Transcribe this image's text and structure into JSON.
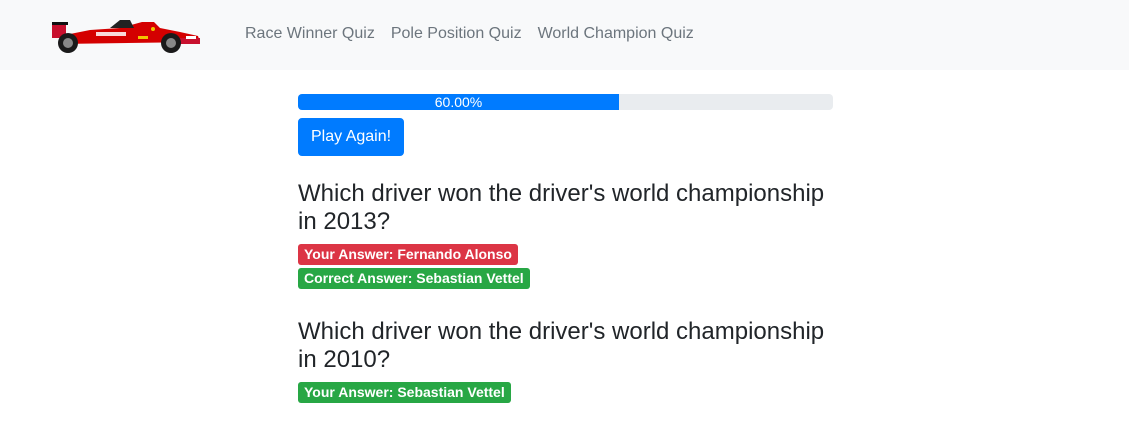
{
  "navbar": {
    "logo_icon": "f1-car-icon",
    "links": [
      {
        "label": "Race Winner Quiz"
      },
      {
        "label": "Pole Position Quiz"
      },
      {
        "label": "World Champion Quiz"
      }
    ]
  },
  "progress": {
    "value": 0.6,
    "label": "60.00%"
  },
  "play_again_label": "Play Again!",
  "questions": [
    {
      "title": "Which driver won the driver's world championship in 2013?",
      "your_answer": "Your Answer: Fernando Alonso",
      "correct_answer": "Correct Answer: Sebastian Vettel"
    },
    {
      "title": "Which driver won the driver's world championship in 2010?",
      "your_answer": "Your Answer: Sebastian Vettel"
    }
  ],
  "colors": {
    "primary": "#007bff",
    "danger": "#dc3545",
    "success": "#28a745",
    "navbar_bg": "#f8f9fa"
  }
}
